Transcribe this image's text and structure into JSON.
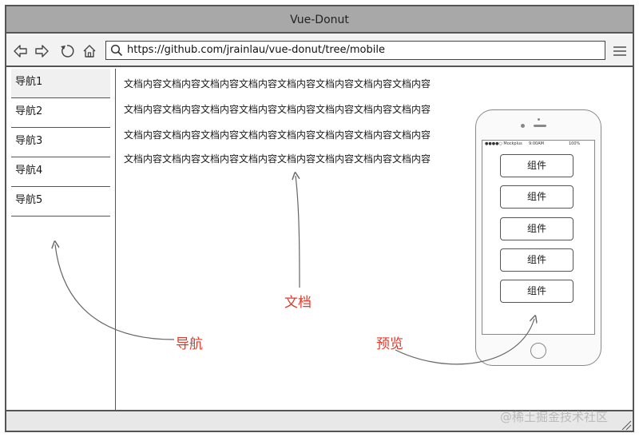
{
  "window": {
    "title": "Vue-Donut"
  },
  "toolbar": {
    "url": "https://github.com/jrainlau/vue-donut/tree/mobile",
    "icons": [
      "back-icon",
      "forward-icon",
      "reload-icon",
      "home-icon",
      "search-icon",
      "menu-icon"
    ]
  },
  "sidebar": {
    "items": [
      {
        "label": "导航1"
      },
      {
        "label": "导航2"
      },
      {
        "label": "导航3"
      },
      {
        "label": "导航4"
      },
      {
        "label": "导航5"
      }
    ]
  },
  "document": {
    "lines": [
      "文档内容文档内容文档内容文档内容文档内容文档内容文档内容文档内容",
      "文档内容文档内容文档内容文档内容文档内容文档内容文档内容文档内容",
      "文档内容文档内容文档内容文档内容文档内容文档内容文档内容文档内容",
      "文档内容文档内容文档内容文档内容文档内容文档内容文档内容文档内容"
    ]
  },
  "preview": {
    "status": {
      "left": "●●●●○ Mockplus",
      "center": "9:00AM",
      "right": "100%"
    },
    "components": [
      "组件",
      "组件",
      "组件",
      "组件",
      "组件"
    ]
  },
  "annotations": {
    "nav": "导航",
    "doc": "文档",
    "preview": "预览",
    "color": "#e03a2b"
  },
  "watermark": "@稀土掘金技术社区"
}
